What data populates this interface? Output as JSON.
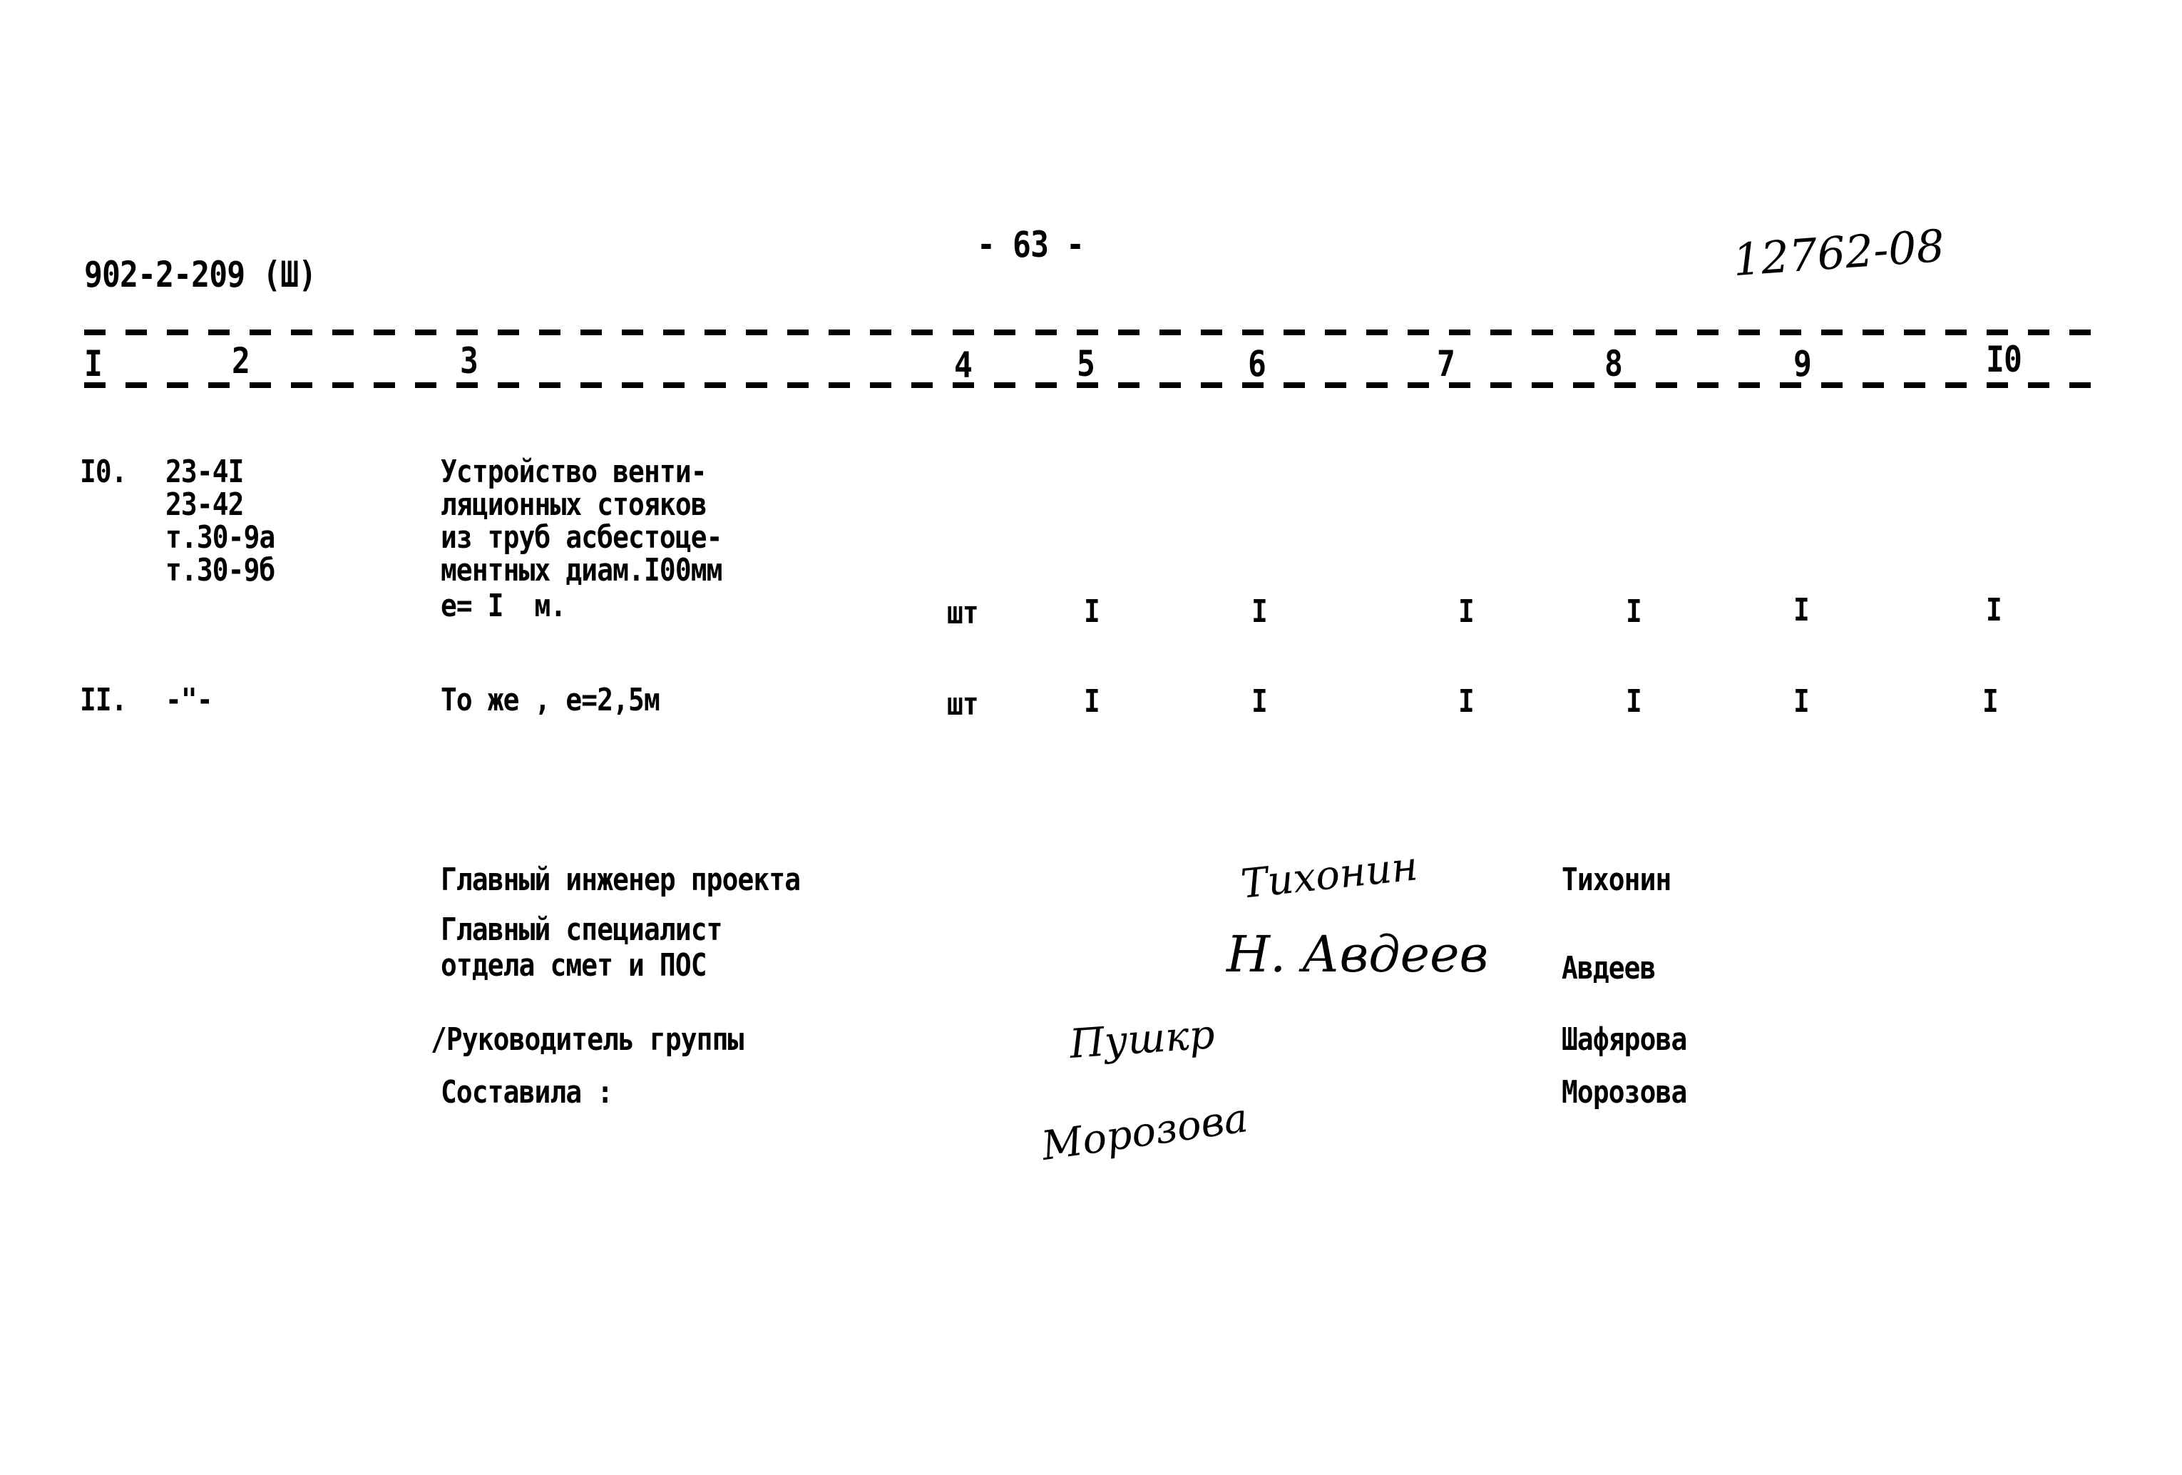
{
  "header": {
    "doc_code": "902-2-209 (Ш)",
    "page_number": "- 63 -",
    "inventory_number": "12762-08"
  },
  "table": {
    "column_numbers": [
      "I",
      "2",
      "3",
      "4",
      "5",
      "6",
      "7",
      "8",
      "9",
      "I0"
    ],
    "rows": [
      {
        "no": "I0.",
        "codes": [
          "23-4I",
          "23-42",
          "т.30-9а",
          "т.30-9б"
        ],
        "description": [
          "Устройство венти-",
          "ляционных стояков",
          "из труб асбестоце-",
          "ментных диам.I00мм",
          "е= I  м."
        ],
        "unit": "шт",
        "values": [
          "I",
          "I",
          "I",
          "I",
          "I",
          "I"
        ]
      },
      {
        "no": "II.",
        "codes": [
          "-\"-"
        ],
        "description": [
          "То же , е=2,5м"
        ],
        "unit": "шт",
        "values": [
          "I",
          "I",
          "I",
          "I",
          "I",
          "I"
        ]
      }
    ]
  },
  "signatures": [
    {
      "role": [
        "Главный инженер проекта"
      ],
      "signature": "Тихонин",
      "name": "Тихонин"
    },
    {
      "role": [
        "Главный специалист",
        "отдела смет и ПОС"
      ],
      "signature": "Н. Авдеев",
      "name": "Авдеев"
    },
    {
      "role": [
        "/Руководитель группы"
      ],
      "signature": "Пушкр",
      "name": "Шафярова"
    },
    {
      "role": [
        "Составила :"
      ],
      "signature": "Морозова",
      "name": "Морозова"
    }
  ]
}
